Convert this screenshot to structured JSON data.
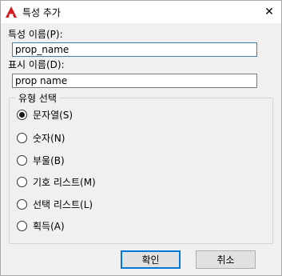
{
  "window": {
    "title": "특성 추가",
    "app_icon": "autocad-logo-icon",
    "close_glyph": "✕"
  },
  "fields": {
    "property_name": {
      "label": "특성 이름(P):",
      "value": "prop_name"
    },
    "display_name": {
      "label": "표시 이름(D):",
      "value": "prop name"
    }
  },
  "type_group": {
    "label": "유형 선택",
    "options": [
      {
        "label": "문자열(S)",
        "checked": true
      },
      {
        "label": "숫자(N)",
        "checked": false
      },
      {
        "label": "부울(B)",
        "checked": false
      },
      {
        "label": "기호 리스트(M)",
        "checked": false
      },
      {
        "label": "선택 리스트(L)",
        "checked": false
      },
      {
        "label": "획득(A)",
        "checked": false
      }
    ]
  },
  "buttons": {
    "ok": "확인",
    "cancel": "취소"
  },
  "colors": {
    "accent": "#0078d7",
    "logo_red": "#d4161a"
  }
}
